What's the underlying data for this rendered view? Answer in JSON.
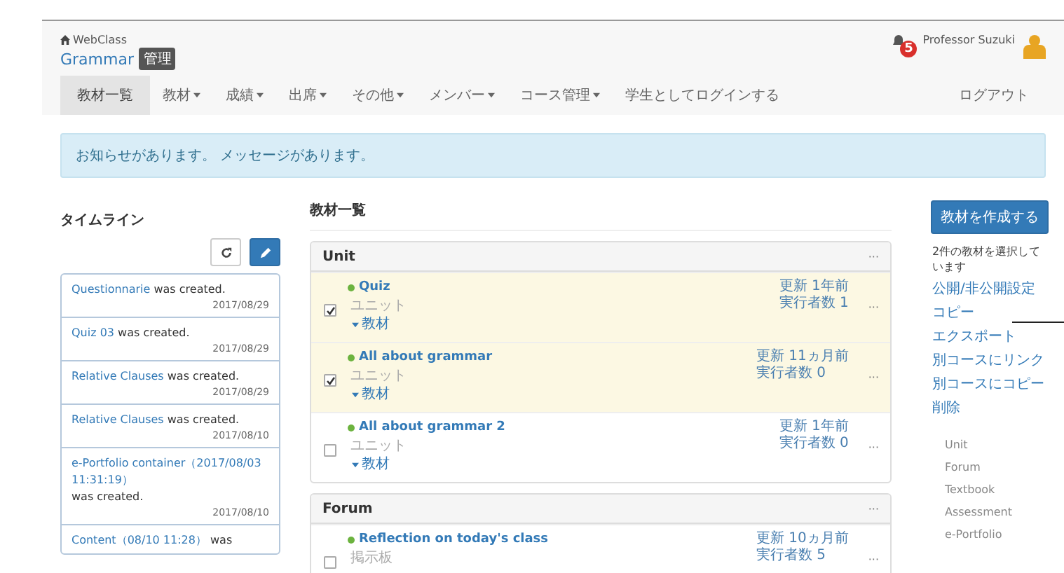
{
  "header": {
    "site": "WebClass",
    "course": "Grammar",
    "role_badge": "管理",
    "notification_count": "5",
    "user": "Professor Suzuki"
  },
  "nav": {
    "tabs": [
      {
        "label": "教材一覧",
        "selected": true,
        "dropdown": false
      },
      {
        "label": "教材",
        "selected": false,
        "dropdown": true
      },
      {
        "label": "成績",
        "selected": false,
        "dropdown": true
      },
      {
        "label": "出席",
        "selected": false,
        "dropdown": true
      },
      {
        "label": "その他",
        "selected": false,
        "dropdown": true
      },
      {
        "label": "メンバー",
        "selected": false,
        "dropdown": true
      },
      {
        "label": "コース管理",
        "selected": false,
        "dropdown": true
      },
      {
        "label": "学生としてログインする",
        "selected": false,
        "dropdown": false
      }
    ],
    "logout": "ログアウト"
  },
  "alert": "お知らせがあります。 メッセージがあります。",
  "timeline": {
    "title": "タイムライン",
    "items": [
      {
        "link": "Questionnarie",
        "text": "was created.",
        "date": "2017/08/29"
      },
      {
        "link": "Quiz 03",
        "text": "was created.",
        "date": "2017/08/29"
      },
      {
        "link": "Relative Clauses",
        "text": "was created.",
        "date": "2017/08/29"
      },
      {
        "link": "Relative Clauses",
        "text": "was created.",
        "date": "2017/08/10"
      },
      {
        "link": "e-Portfolio container（2017/08/03 11:31:19）",
        "text": "was created.",
        "date": "2017/08/10"
      },
      {
        "link": "Content（08/10 11:28）",
        "text": "was"
      }
    ]
  },
  "materials": {
    "title": "教材一覧",
    "sections": [
      {
        "name": "Unit",
        "menu": "···",
        "rows": [
          {
            "title": "Quiz",
            "type": "ユニット",
            "sub": "教材",
            "updated": "更新 1年前",
            "count": "実行者数 1",
            "menu": "···",
            "checked": true
          },
          {
            "title": "All about grammar",
            "type": "ユニット",
            "sub": "教材",
            "updated": "更新 11ヵ月前",
            "count": "実行者数 0",
            "menu": "···",
            "checked": true
          },
          {
            "title": "All about grammar 2",
            "type": "ユニット",
            "sub": "教材",
            "updated": "更新 1年前",
            "count": "実行者数 0",
            "menu": "···",
            "checked": false
          }
        ]
      },
      {
        "name": "Forum",
        "menu": "···",
        "rows": [
          {
            "title": "Reflection on today's class",
            "type": "掲示板",
            "updated": "更新 10ヵ月前",
            "count": "実行者数 5",
            "menu": "···",
            "checked": false
          }
        ]
      }
    ]
  },
  "side": {
    "create_button": "教材を作成する",
    "selection_note": "2件の教材を選択しています",
    "actions": [
      "公開/非公開設定",
      "コピー",
      "エクスポート",
      "別コースにリンク",
      "別コースにコピー",
      "削除"
    ],
    "categories": [
      "Unit",
      "Forum",
      "Textbook",
      "Assessment",
      "e-Portfolio"
    ]
  }
}
